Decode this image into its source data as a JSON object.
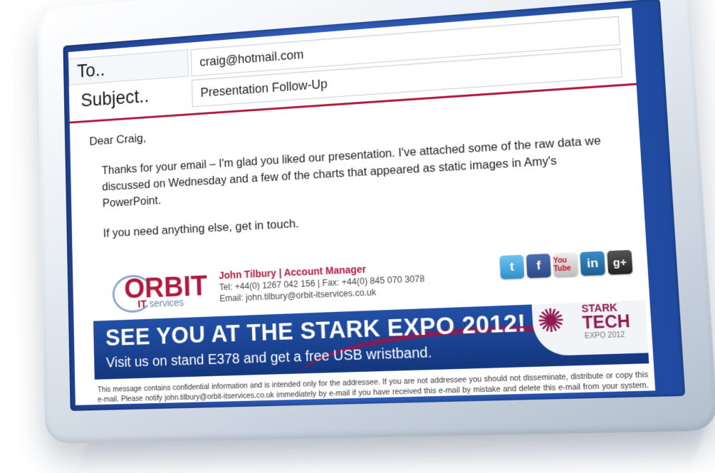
{
  "email": {
    "to_label": "To..",
    "to_value": "craig@hotmail.com",
    "subject_label": "Subject..",
    "subject_value": "Presentation Follow-Up",
    "greeting": "Dear Craig,",
    "paragraph1": "Thanks for your email – I'm glad you liked our presentation. I've attached some of the raw data we discussed on Wednesday and a few of the charts that appeared as static images in Amy's PowerPoint.",
    "paragraph2": "If you need anything else, get in touch."
  },
  "signature": {
    "logo_text": "ORBIT",
    "logo_sub_it": "IT",
    "logo_sub_services": "services",
    "name_line": "John Tilbury  |  Account Manager",
    "tel_line": "Tel: +44(0) 1267 042 156  |  Fax: +44(0) 845 070 3078",
    "email_line": "Email: john.tilbury@orbit-itservices.co.uk",
    "socials": {
      "twitter": "t",
      "facebook": "f",
      "youtube": "You Tube",
      "linkedin": "in",
      "googleplus": "g+"
    }
  },
  "banner": {
    "headline": "SEE YOU AT THE STARK EXPO 2012!",
    "subline": "Visit us on stand E378 and get a free USB wristband.",
    "logo_line1": "STARK",
    "logo_line2": "TECH",
    "logo_line3": "EXPO 2012"
  },
  "disclaimer": "This message contains confidential information and is intended only for the addressee. If you are not addressee you should not disseminate, distribute or copy this e-mail. Please notify john.tilbury@orbit-itservices.co.uk immediately by e-mail if you have received this e-mail by mistake and delete this e-mail from your system. E-mail transmission cannot be guaranteed to be secure or error-free as information could be intercepted, corrupted, lost, destroyed, arrive late or incomplete, or contain viruses. Orbit IT Services therefore does not accept liability for any errors or omissions in the contents of this message, which arise as a result of e-mail transmission. If verification is required please request a hard-copy version.",
  "colors": {
    "accent_red": "#b11a3e",
    "screen_blue": "#2f5cb8",
    "banner_blue": "#1c4596"
  }
}
